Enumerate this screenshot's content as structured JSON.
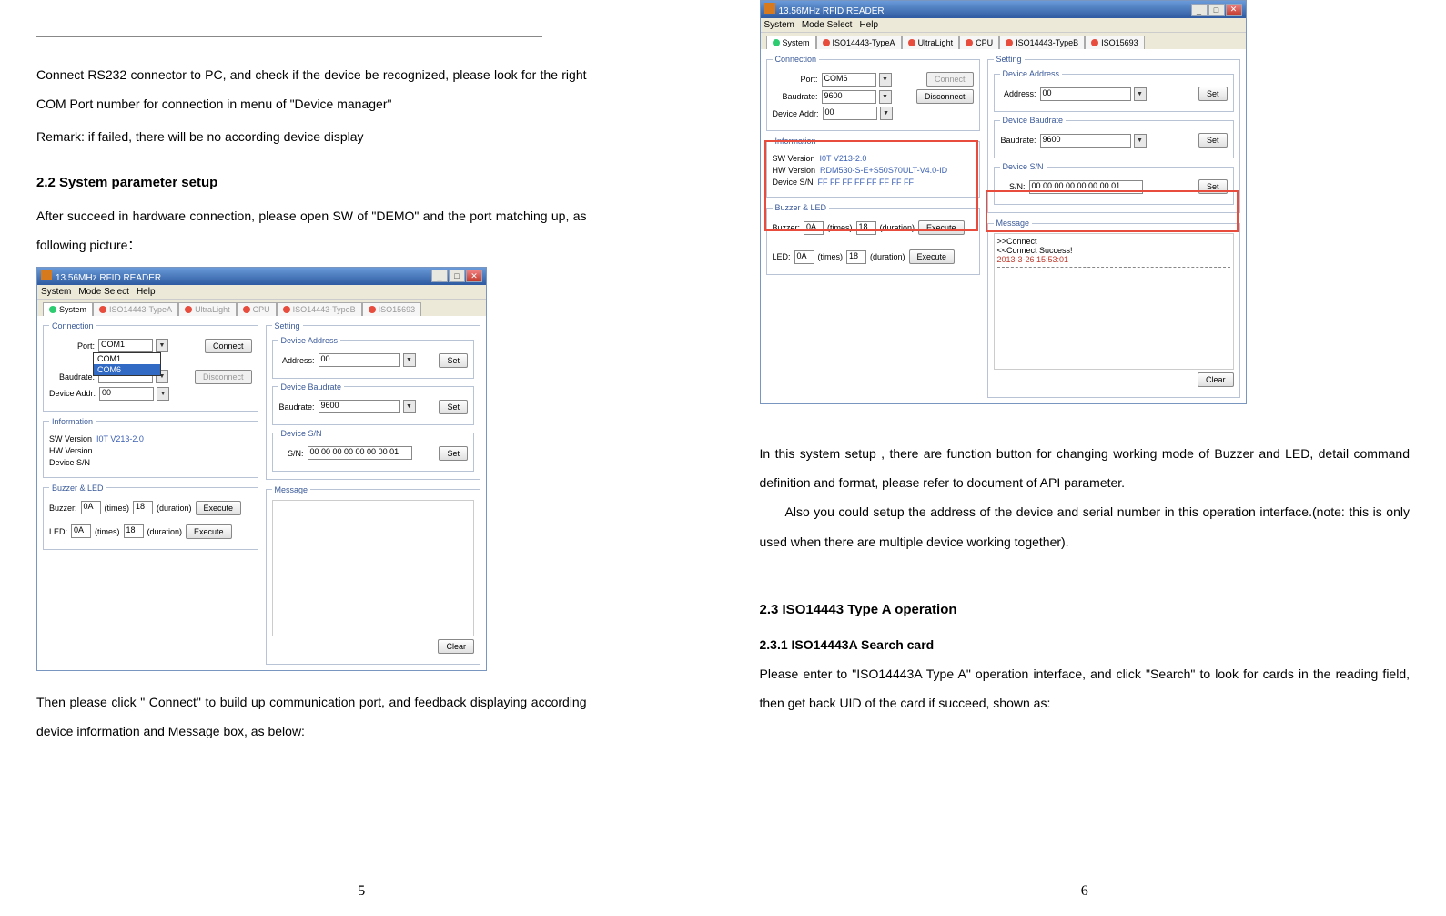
{
  "left": {
    "para1": "Connect RS232 connector to PC, and check if the device be recognized, please look for the right COM Port number for connection in menu of \"Device manager\"",
    "para2": "Remark: if failed, there will be no according device display",
    "h2": "2.2    System parameter setup",
    "para3": "After succeed in hardware connection, please open SW of \"DEMO\" and the port matching up, as following picture：",
    "para4": "Then please click \" Connect\" to build up communication port, and feedback displaying according device information and Message box, as below:",
    "pageNum": "5"
  },
  "right": {
    "para1": "In this system setup , there are function button for changing working mode of Buzzer and LED, detail command definition and format, please refer to document of API parameter.",
    "para2": "Also you could setup the address of the device and serial number in this operation interface.(note: this is only used when there are multiple device working together).",
    "h23": "2.3    ISO14443 Type A operation",
    "h231": "2.3.1    ISO14443A    Search card",
    "para3": "Please enter to \"ISO14443A Type A\" operation interface, and click \"Search\" to look for cards in the reading field, then get back UID of the card if succeed, shown as:",
    "pageNum": "6"
  },
  "app": {
    "title": "13.56MHz RFID READER",
    "menu": {
      "m1": "System",
      "m2": "Mode Select",
      "m3": "Help"
    },
    "tabs": {
      "t1": "System",
      "t2": "ISO14443-TypeA",
      "t3": "UltraLight",
      "t4": "CPU",
      "t5": "ISO14443-TypeB",
      "t6": "ISO15693"
    },
    "conn": {
      "legend": "Connection",
      "portLbl": "Port:",
      "portVal1": "COM1",
      "portOpt1": "COM1",
      "portOpt2": "COM6",
      "portVal2": "COM6",
      "baudLbl": "Baudrate:",
      "baudVal1": "",
      "baudVal2": "9600",
      "addrLbl": "Device Addr:",
      "addrVal": "00",
      "btnConnect": "Connect",
      "btnDisconnect": "Disconnect"
    },
    "info": {
      "legend": "Information",
      "swLbl": "SW Version",
      "swVal": "I0T V213-2.0",
      "hwLbl": "HW Version",
      "hwVal": "RDM530-S-E+S50S70ULT-V4.0-ID",
      "snLbl": "Device S/N",
      "snVal": "FF FF FF FF FF FF FF FF"
    },
    "buz": {
      "legend": "Buzzer & LED",
      "buzLbl": "Buzzer:",
      "buzVal": "0A",
      "timesLbl": "(times)",
      "timesVal": "18",
      "durLbl": "(duration)",
      "ledLbl": "LED:",
      "ledVal": "0A",
      "btnExec": "Execute"
    },
    "setting": {
      "legend": "Setting",
      "devAddr": "Device Address",
      "addrLbl": "Address:",
      "addrVal": "00",
      "devBaud": "Device Baudrate",
      "baudLbl": "Baudrate:",
      "baudVal": "9600",
      "devSN": "Device S/N",
      "snLbl": "S/N:",
      "snVal": "00 00 00 00 00 00 00 01",
      "btnSet": "Set"
    },
    "msg": {
      "legend": "Message",
      "l1": ">>Connect",
      "l2": "<<Connect Success!",
      "l3": "2013-3-26  15:53:01",
      "btnClear": "Clear"
    }
  }
}
